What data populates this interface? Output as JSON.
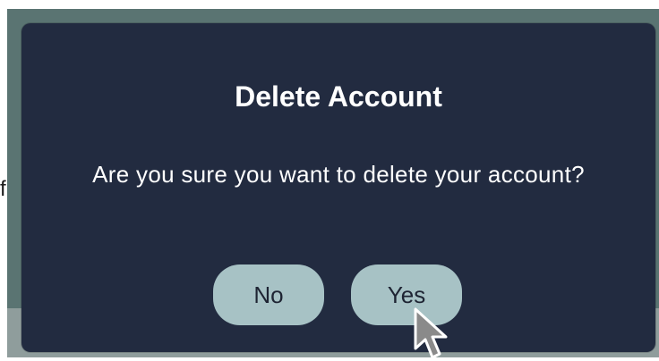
{
  "backdrop": {
    "partial_text": "f"
  },
  "dialog": {
    "title": "Delete Account",
    "message": "Are you sure you want to delete your account?",
    "buttons": {
      "no": "No",
      "yes": "Yes"
    }
  },
  "cursor": {
    "icon": "mouse-pointer-icon"
  },
  "colors": {
    "dialog_background": "#222b40",
    "button_background": "#a7c2c5",
    "backdrop": "#5a7472"
  }
}
